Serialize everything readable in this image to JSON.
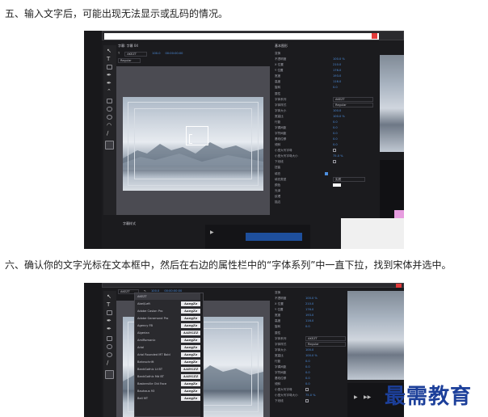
{
  "steps": {
    "step5": "五、输入文字后，可能出现无法显示或乱码的情况。",
    "step6": "六、确认你的文字光标在文本框中，然后在右边的属性栏中的“字体系列”中一直下拉，找到宋体并选中。"
  },
  "shot1": {
    "font_value": "AKEZT",
    "style_value": "Regular",
    "size_value": "100.0",
    "time_value": "00:00:00:00",
    "panel_title": "基本图形",
    "bottom_panel_label": "字幕样式",
    "properties": [
      {
        "label": "变换",
        "value": ""
      },
      {
        "label": "不透明度",
        "value": "100.0 %"
      },
      {
        "label": "X 位置",
        "value": "210.0"
      },
      {
        "label": "Y 位置",
        "value": "176.0"
      },
      {
        "label": "宽度",
        "value": "193.0"
      },
      {
        "label": "高度",
        "value": "116.0"
      },
      {
        "label": "旋转",
        "value": "0.0"
      },
      {
        "label": "属性",
        "value": ""
      },
      {
        "label": "字体系列",
        "value": ""
      },
      {
        "label": "字体样式",
        "value": ""
      },
      {
        "label": "字体大小",
        "value": "100.0"
      },
      {
        "label": "宽高比",
        "value": "100.0 %"
      },
      {
        "label": "行距",
        "value": "0.0"
      },
      {
        "label": "字偶间距",
        "value": "0.0"
      },
      {
        "label": "字符间距",
        "value": "0.0"
      },
      {
        "label": "基线位移",
        "value": "0.0"
      },
      {
        "label": "倾斜",
        "value": "0.0"
      },
      {
        "label": "小型大写字母",
        "value": ""
      },
      {
        "label": "小型大写字母大小",
        "value": "75.0 %"
      },
      {
        "label": "下划线",
        "value": ""
      },
      {
        "label": "扭曲",
        "value": ""
      },
      {
        "label": "填充",
        "value": ""
      },
      {
        "label": "填充类型",
        "value": ""
      },
      {
        "label": "颜色",
        "value": ""
      },
      {
        "label": "光泽",
        "value": ""
      },
      {
        "label": "纹理",
        "value": ""
      },
      {
        "label": "描边",
        "value": ""
      }
    ],
    "font_dropdown": "AKEZT",
    "style_dropdown": "Regular",
    "fill_dropdown": "实底"
  },
  "shot2": {
    "font_value": "AKEZT",
    "style_value": "Regular",
    "size_value": "100.0",
    "time_value": "00:00:00:00",
    "font_list": [
      "AKEZT",
      "Abel/Left",
      "Adobe Caslon Pro",
      "Adobe Garamond Pro",
      "Agency FB",
      "Algerian",
      "AmiRomanic",
      "Arial",
      "Arial Rounded MT Bold",
      "Bahnschrift",
      "BankGothic Lt BT",
      "BankGothic Md BT",
      "Baskerville Old Face",
      "Bauhaus 93",
      "Bell MT"
    ],
    "font_samples": [
      "",
      "AaegZz",
      "AaegZz",
      "AaegZz",
      "AaegZz",
      "AAEGZZ",
      "AaegZz",
      "AaegZz",
      "AaegZz",
      "AaegZz",
      "AAEGZZ",
      "AAEGZZ",
      "AaegZz",
      "AaegZz",
      "AaegZz"
    ],
    "properties": [
      {
        "label": "变换",
        "value": ""
      },
      {
        "label": "不透明度",
        "value": "100.0 %"
      },
      {
        "label": "X 位置",
        "value": "210.0"
      },
      {
        "label": "Y 位置",
        "value": "176.0"
      },
      {
        "label": "宽度",
        "value": "193.0"
      },
      {
        "label": "高度",
        "value": "116.0"
      },
      {
        "label": "旋转",
        "value": "0.0"
      },
      {
        "label": "属性",
        "value": ""
      },
      {
        "label": "字体系列",
        "value": ""
      },
      {
        "label": "字体样式",
        "value": ""
      },
      {
        "label": "字体大小",
        "value": "100.0"
      },
      {
        "label": "宽高比",
        "value": "100.0 %"
      },
      {
        "label": "行距",
        "value": "0.0"
      },
      {
        "label": "字偶间距",
        "value": "0.0"
      },
      {
        "label": "字符间距",
        "value": "0.0"
      },
      {
        "label": "基线位移",
        "value": "0.0"
      },
      {
        "label": "倾斜",
        "value": "0.0"
      },
      {
        "label": "小型大写字母",
        "value": ""
      },
      {
        "label": "小型大写字母大小",
        "value": "75.0 %"
      },
      {
        "label": "下划线",
        "value": ""
      }
    ],
    "font_dropdown": "AKEZT",
    "style_dropdown": "Regular"
  },
  "watermark": "最需教育",
  "colors": {
    "accent_blue": "#4d8fe0",
    "close_red": "#e23a3a",
    "watermark_blue": "#1c3f9a"
  }
}
